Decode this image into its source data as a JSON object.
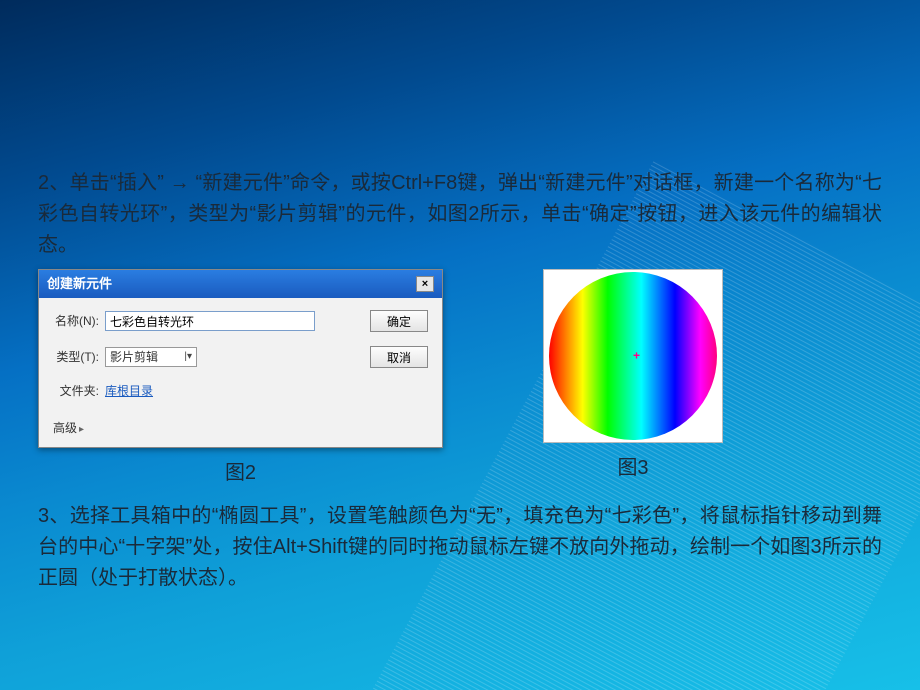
{
  "para2": "2、单击“插入” → “新建元件”命令，或按Ctrl+F8键，弹出“新建元件”对话框，新建一个名称为“七彩色自转光环”，类型为“影片剪辑”的元件，如图2所示，单击“确定”按钮，进入该元件的编辑状态。",
  "dialog": {
    "title": "创建新元件",
    "close": "×",
    "name_label": "名称(N):",
    "name_value": "七彩色自转光环",
    "type_label": "类型(T):",
    "type_value": "影片剪辑",
    "folder_label": "文件夹:",
    "folder_value": "库根目录",
    "advanced": "高级",
    "ok": "确定",
    "cancel": "取消"
  },
  "caption2": "图2",
  "caption3": "图3",
  "centerplus": "+",
  "para3": "3、选择工具箱中的“椭圆工具”，设置笔触颜色为“无”，填充色为“七彩色”，将鼠标指针移动到舞台的中心“十字架”处，按住Alt+Shift键的同时拖动鼠标左键不放向外拖动，绘制一个如图3所示的正圆（处于打散状态）。"
}
